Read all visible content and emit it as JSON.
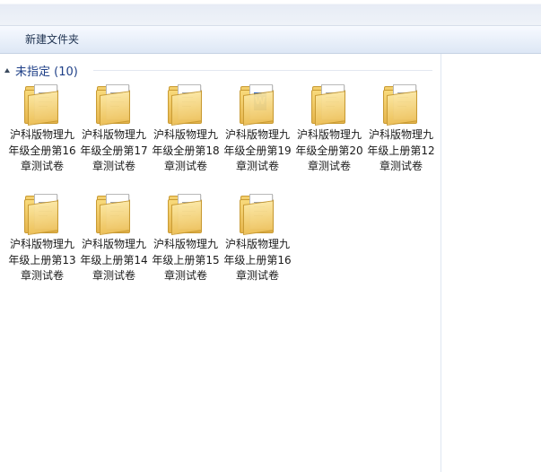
{
  "toolbar": {
    "new_folder_label": "新建文件夹"
  },
  "group": {
    "title": "未指定 (10)"
  },
  "items": [
    {
      "label": "沪科版物理九年级全册第16章测试卷",
      "icon": "folder-icon"
    },
    {
      "label": "沪科版物理九年级全册第17章测试卷",
      "icon": "folder-icon"
    },
    {
      "label": "沪科版物理九年级全册第18章测试卷",
      "icon": "folder-icon"
    },
    {
      "label": "沪科版物理九年级全册第19章测试卷",
      "icon": "folder-word-icon"
    },
    {
      "label": "沪科版物理九年级全册第20章测试卷",
      "icon": "folder-icon"
    },
    {
      "label": "沪科版物理九年级上册第12章测试卷",
      "icon": "folder-icon"
    },
    {
      "label": "沪科版物理九年级上册第13章测试卷",
      "icon": "folder-icon"
    },
    {
      "label": "沪科版物理九年级上册第14章测试卷",
      "icon": "folder-icon"
    },
    {
      "label": "沪科版物理九年级上册第15章测试卷",
      "icon": "folder-icon"
    },
    {
      "label": "沪科版物理九年级上册第16章测试卷",
      "icon": "folder-icon"
    }
  ]
}
